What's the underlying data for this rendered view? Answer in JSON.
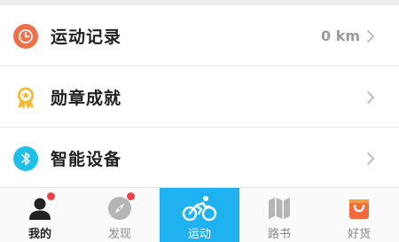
{
  "menu": {
    "items": [
      {
        "label": "运动记录",
        "value": "0 km",
        "icon": "clock-icon",
        "color": "#f0704a"
      },
      {
        "label": "勋章成就",
        "icon": "medal-icon",
        "color": "#f5b82e"
      },
      {
        "label": "智能设备",
        "icon": "bluetooth-icon",
        "color": "#1fbfe9"
      }
    ]
  },
  "tabbar": {
    "tabs": [
      {
        "label": "我的",
        "icon": "user-icon",
        "badge": true
      },
      {
        "label": "发现",
        "icon": "compass-icon",
        "badge": true
      },
      {
        "label": "运动",
        "icon": "bicycle-icon",
        "active": true
      },
      {
        "label": "路书",
        "icon": "map-icon"
      },
      {
        "label": "好货",
        "icon": "shopping-bag-icon"
      }
    ],
    "active_color": "#20b2f0",
    "badge_color": "#f04144"
  }
}
